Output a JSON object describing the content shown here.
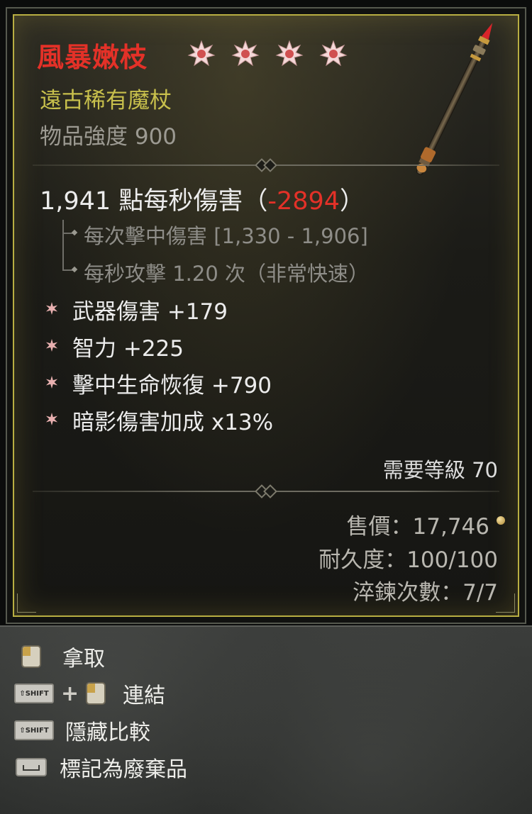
{
  "item": {
    "name": "風暴嫩枝",
    "rarity": "遠古稀有魔杖",
    "power": "物品強度 900",
    "star_count": 4,
    "image_icon": "wand-icon"
  },
  "damage": {
    "dps_value": "1,941 點每秒傷害（",
    "dps_delta": "-2894",
    "dps_close": "）",
    "per_hit": "每次擊中傷害 [1,330 - 1,906]",
    "attack_speed": "每秒攻擊 1.20 次（非常快速）"
  },
  "affixes": [
    "武器傷害 +179",
    "智力 +225",
    "擊中生命恢復 +790",
    "暗影傷害加成 x13%"
  ],
  "requirements": {
    "level": "需要等級 70"
  },
  "stats": {
    "sell_price": "售價：17,746",
    "durability": "耐久度：100/100",
    "temper": "淬鍊次數：7/7"
  },
  "controls": {
    "take": "拿取",
    "link": "連結",
    "hide_compare": "隱藏比較",
    "mark_junk": "標記為廢棄品",
    "shift_label": "SHIFT",
    "plus": "+"
  },
  "colors": {
    "name": "#e33128",
    "rarity": "#c8c04c",
    "frame": "#b8ae42",
    "affix_star": "#e8a0a0"
  }
}
